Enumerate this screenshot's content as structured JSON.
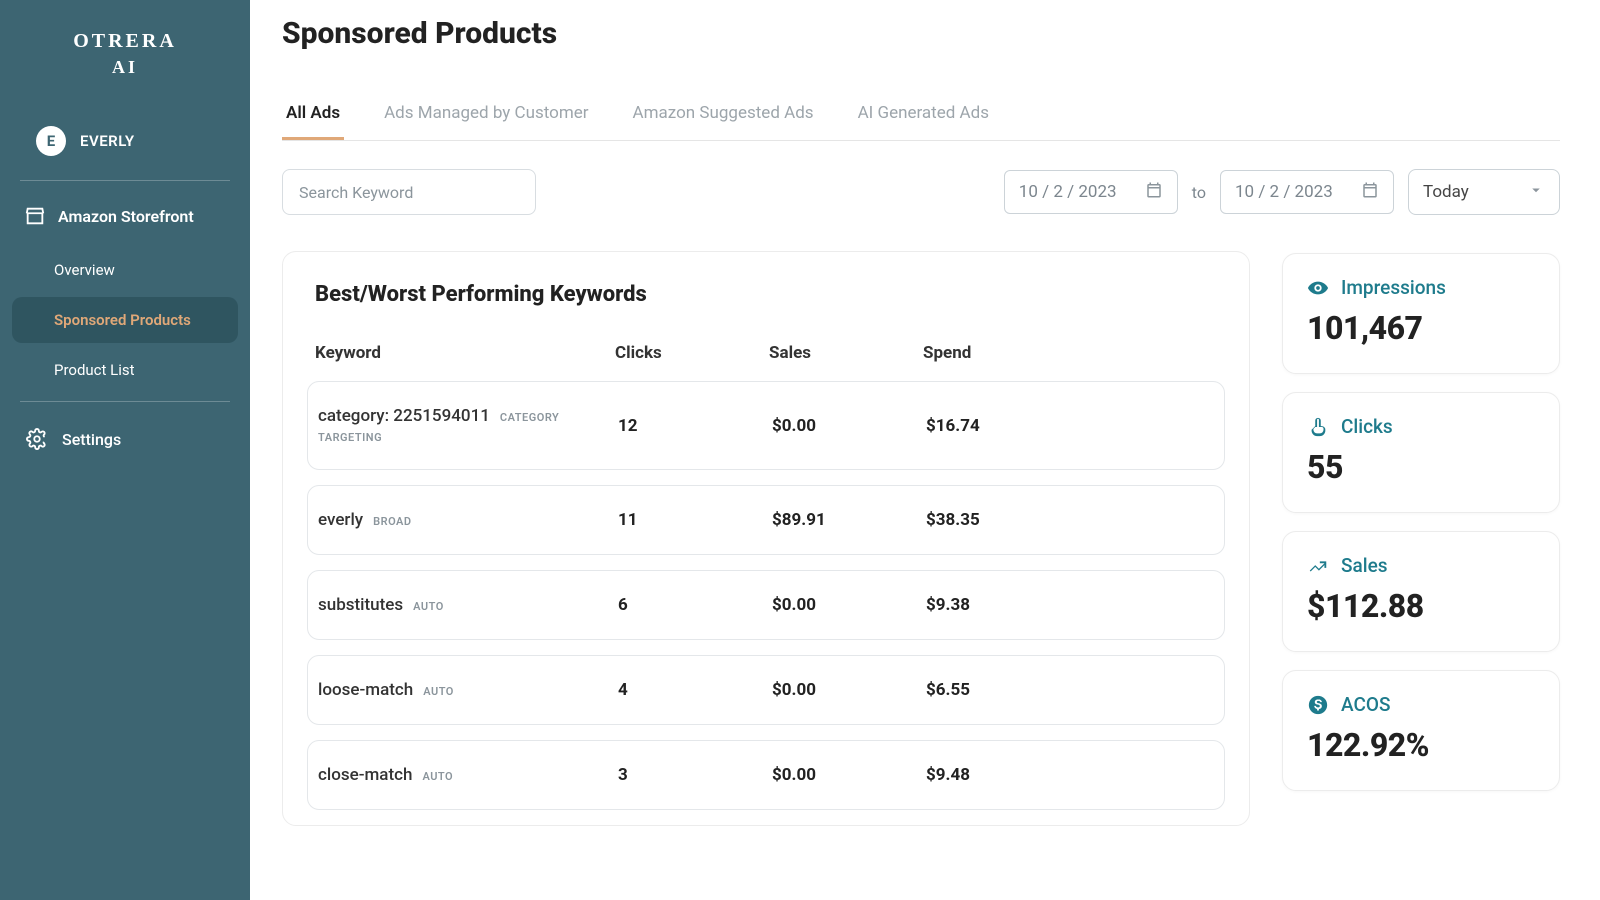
{
  "brand": {
    "line1": "OTRERA",
    "line2": "AI"
  },
  "user": {
    "initial": "E",
    "name": "EVERLY"
  },
  "sidebar": {
    "section": "Amazon Storefront",
    "items": [
      {
        "label": "Overview"
      },
      {
        "label": "Sponsored Products"
      },
      {
        "label": "Product List"
      }
    ],
    "settings": "Settings"
  },
  "page": {
    "title": "Sponsored Products"
  },
  "tabs": [
    {
      "label": "All Ads"
    },
    {
      "label": "Ads Managed by Customer"
    },
    {
      "label": "Amazon Suggested Ads"
    },
    {
      "label": "AI Generated Ads"
    }
  ],
  "filters": {
    "search_placeholder": "Search Keyword",
    "date_from": "10 / 2 / 2023",
    "to_label": "to",
    "date_to": "10 / 2 / 2023",
    "period": "Today"
  },
  "panel": {
    "title": "Best/Worst Performing Keywords",
    "headers": {
      "keyword": "Keyword",
      "clicks": "Clicks",
      "sales": "Sales",
      "spend": "Spend"
    },
    "rows": [
      {
        "keyword": "category: 2251594011",
        "tag": "CATEGORY TARGETING",
        "clicks": "12",
        "sales": "$0.00",
        "spend": "$16.74"
      },
      {
        "keyword": "everly",
        "tag": "BROAD",
        "clicks": "11",
        "sales": "$89.91",
        "spend": "$38.35"
      },
      {
        "keyword": "substitutes",
        "tag": "AUTO",
        "clicks": "6",
        "sales": "$0.00",
        "spend": "$9.38"
      },
      {
        "keyword": "loose-match",
        "tag": "AUTO",
        "clicks": "4",
        "sales": "$0.00",
        "spend": "$6.55"
      },
      {
        "keyword": "close-match",
        "tag": "AUTO",
        "clicks": "3",
        "sales": "$0.00",
        "spend": "$9.48"
      }
    ]
  },
  "kpis": [
    {
      "label": "Impressions",
      "value": "101,467",
      "icon": "eye"
    },
    {
      "label": "Clicks",
      "value": "55",
      "icon": "touch"
    },
    {
      "label": "Sales",
      "value": "$112.88",
      "icon": "trend"
    },
    {
      "label": "ACOS",
      "value": "122.92%",
      "icon": "dollar"
    }
  ]
}
